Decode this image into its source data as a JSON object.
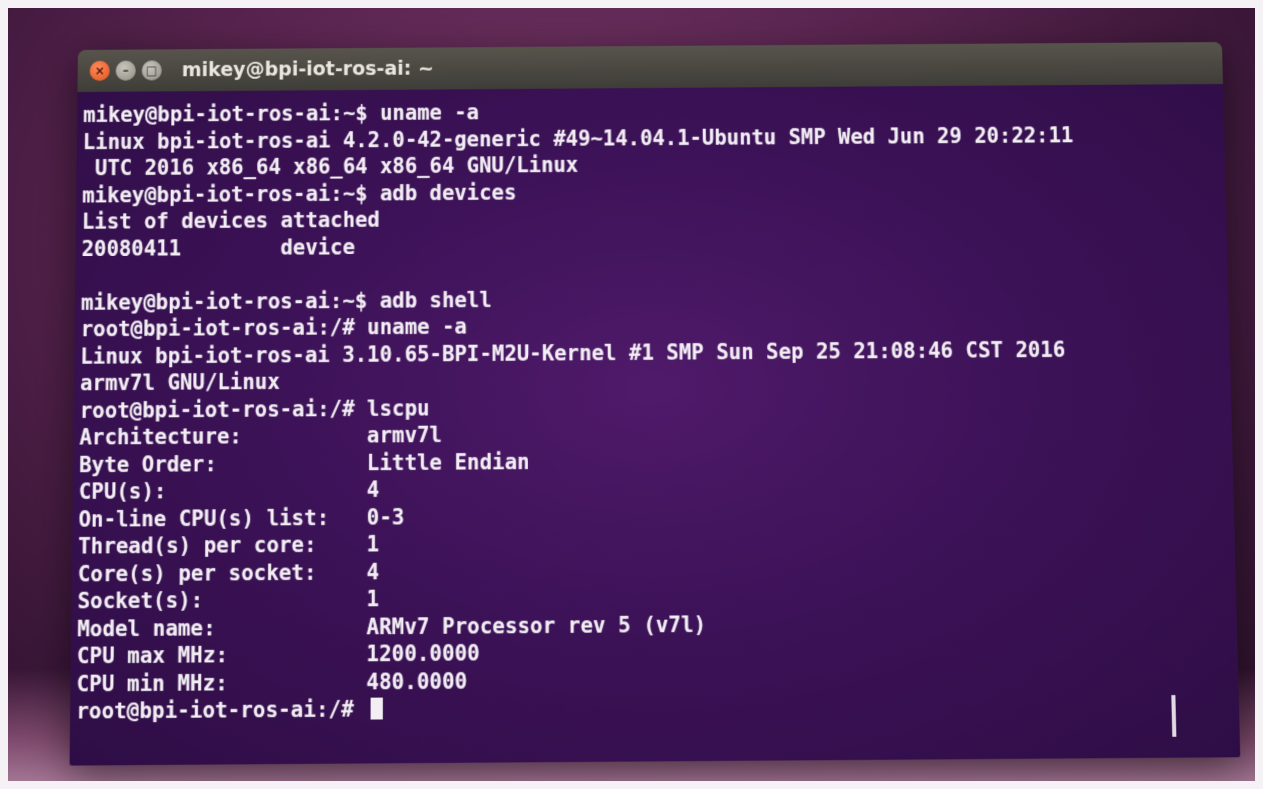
{
  "window": {
    "title": "mikey@bpi-iot-ros-ai: ~",
    "buttons": {
      "close": "×",
      "minimize": "–",
      "maximize": "□"
    }
  },
  "terminal": {
    "lines": [
      "mikey@bpi-iot-ros-ai:~$ uname -a",
      "Linux bpi-iot-ros-ai 4.2.0-42-generic #49~14.04.1-Ubuntu SMP Wed Jun 29 20:22:11",
      " UTC 2016 x86_64 x86_64 x86_64 GNU/Linux",
      "mikey@bpi-iot-ros-ai:~$ adb devices",
      "List of devices attached",
      "20080411        device",
      "",
      "mikey@bpi-iot-ros-ai:~$ adb shell",
      "root@bpi-iot-ros-ai:/# uname -a",
      "Linux bpi-iot-ros-ai 3.10.65-BPI-M2U-Kernel #1 SMP Sun Sep 25 21:08:46 CST 2016",
      "armv7l GNU/Linux",
      "root@bpi-iot-ros-ai:/# lscpu",
      "Architecture:          armv7l",
      "Byte Order:            Little Endian",
      "CPU(s):                4",
      "On-line CPU(s) list:   0-3",
      "Thread(s) per core:    1",
      "Core(s) per socket:    4",
      "Socket(s):             1",
      "Model name:            ARMv7 Processor rev 5 (v7l)",
      "CPU max MHz:           1200.0000",
      "CPU min MHz:           480.0000"
    ],
    "prompt": "root@bpi-iot-ros-ai:/# "
  },
  "colors": {
    "terminal_bg": "#3d1258",
    "terminal_fg": "#f2eef4",
    "titlebar": "#4a4843",
    "close_button": "#e2531c"
  }
}
